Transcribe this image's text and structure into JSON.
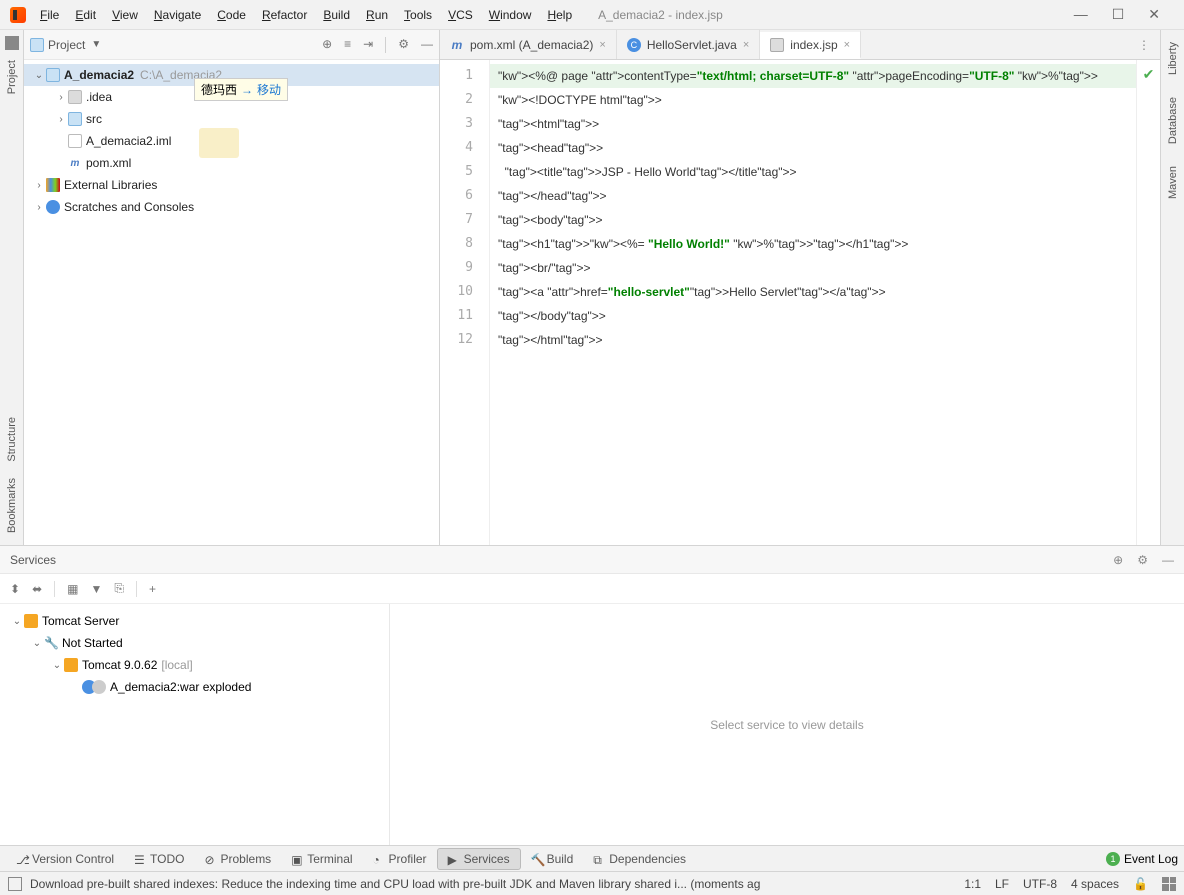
{
  "window": {
    "title": "A_demacia2 - index.jsp"
  },
  "menubar": [
    "File",
    "Edit",
    "View",
    "Navigate",
    "Code",
    "Refactor",
    "Build",
    "Run",
    "Tools",
    "VCS",
    "Window",
    "Help"
  ],
  "project_panel": {
    "title": "Project",
    "root": {
      "name": "A_demacia2",
      "path": "C:\\A_demacia2"
    },
    "drag_hint": {
      "text": "德玛西",
      "action": "移动"
    },
    "children": [
      {
        "name": ".idea",
        "type": "folder"
      },
      {
        "name": "src",
        "type": "folder"
      },
      {
        "name": "A_demacia2.iml",
        "type": "file"
      },
      {
        "name": "pom.xml",
        "type": "maven"
      }
    ],
    "ext_lib": "External Libraries",
    "scratches": "Scratches and Consoles"
  },
  "tabs": [
    {
      "label": "pom.xml (A_demacia2)",
      "icon": "maven"
    },
    {
      "label": "HelloServlet.java",
      "icon": "java"
    },
    {
      "label": "index.jsp",
      "icon": "jsp",
      "active": true
    }
  ],
  "code": {
    "lines": [
      "<%@ page contentType=\"text/html; charset=UTF-8\" pageEncoding=\"UTF-8\" %>",
      "<!DOCTYPE html>",
      "<html>",
      "<head>",
      "  <title>JSP - Hello World</title>",
      "</head>",
      "<body>",
      "<h1><%= \"Hello World!\" %></h1>",
      "<br/>",
      "<a href=\"hello-servlet\">Hello Servlet</a>",
      "</body>",
      "</html>"
    ]
  },
  "right_gutter": [
    "Liberty",
    "Database",
    "Maven"
  ],
  "left_gutter_top": "Project",
  "left_gutter_bottom": [
    "Structure",
    "Bookmarks"
  ],
  "services": {
    "title": "Services",
    "detail_placeholder": "Select service to view details",
    "tree": {
      "root": "Tomcat Server",
      "status": "Not Started",
      "instance": "Tomcat 9.0.62",
      "instance_suffix": "[local]",
      "artifact": "A_demacia2:war exploded"
    }
  },
  "bottom_tabs": [
    {
      "label": "Version Control",
      "icon": "branch"
    },
    {
      "label": "TODO",
      "icon": "list"
    },
    {
      "label": "Problems",
      "icon": "warn"
    },
    {
      "label": "Terminal",
      "icon": "term"
    },
    {
      "label": "Profiler",
      "icon": "prof"
    },
    {
      "label": "Services",
      "icon": "serv",
      "active": true
    },
    {
      "label": "Build",
      "icon": "hammer"
    },
    {
      "label": "Dependencies",
      "icon": "dep"
    }
  ],
  "event_log": {
    "count": "1",
    "label": "Event Log"
  },
  "status": {
    "message": "Download pre-built shared indexes: Reduce the indexing time and CPU load with pre-built JDK and Maven library shared i... (moments ag",
    "pos": "1:1",
    "lf": "LF",
    "encoding": "UTF-8",
    "indent": "4 spaces"
  }
}
